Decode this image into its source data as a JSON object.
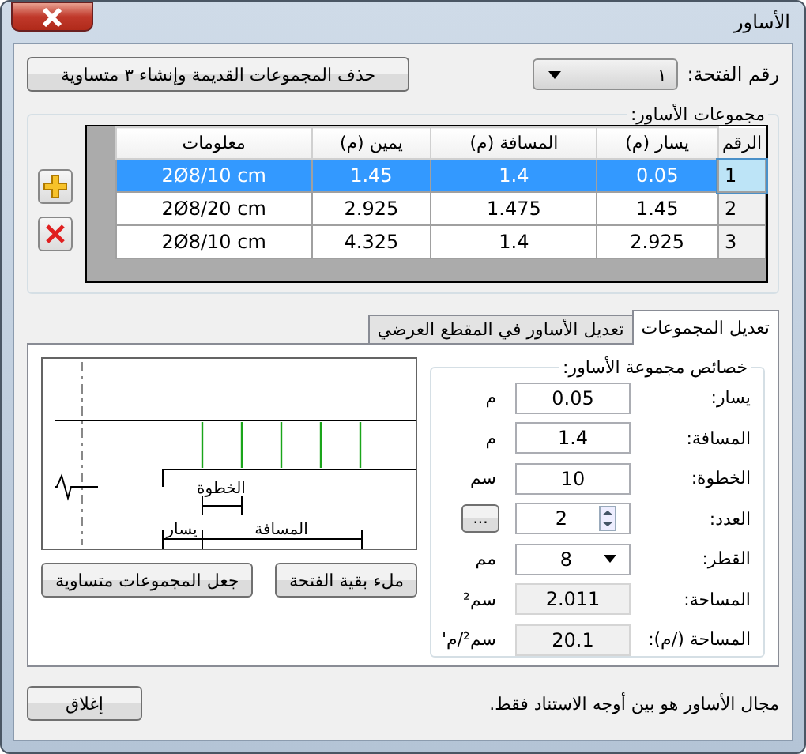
{
  "window": {
    "title": "الأساور"
  },
  "span": {
    "label": "رقم الفتحة:",
    "value": "١"
  },
  "recreate_button": "حذف المجموعات القديمة وإنشاء ٣ متساوية",
  "groups": {
    "title": "مجموعات الأساور:",
    "columns": [
      "الرقم",
      "يسار (م)",
      "المسافة (م)",
      "يمين (م)",
      "معلومات"
    ],
    "rows": [
      {
        "cells": [
          "1",
          "0.05",
          "1.4",
          "1.45",
          "2Ø8/10 cm"
        ],
        "selected": true
      },
      {
        "cells": [
          "2",
          "1.45",
          "1.475",
          "2.925",
          "2Ø8/20 cm"
        ],
        "selected": false
      },
      {
        "cells": [
          "3",
          "2.925",
          "1.4",
          "4.325",
          "2Ø8/10 cm"
        ],
        "selected": false
      }
    ]
  },
  "tabs": [
    {
      "label": "تعديل المجموعات",
      "selected": true
    },
    {
      "label": "تعديل الأساور في المقطع العرضي",
      "selected": false
    }
  ],
  "properties": {
    "title": "خصائص مجموعة الأساور:",
    "fields": [
      {
        "kind": "text",
        "label": "يسار:",
        "value": "0.05",
        "unit": "م"
      },
      {
        "kind": "text",
        "label": "المسافة:",
        "value": "1.4",
        "unit": "م"
      },
      {
        "kind": "text",
        "label": "الخطوة:",
        "value": "10",
        "unit": "سم"
      },
      {
        "kind": "spin",
        "label": "العدد:",
        "value": "2",
        "button": "..."
      },
      {
        "kind": "dropdown",
        "label": "القطر:",
        "value": "8",
        "unit": "مم"
      },
      {
        "kind": "readonly",
        "label": "المساحة:",
        "value": "2.011",
        "unit": "سم²"
      },
      {
        "kind": "readonly",
        "label": "المساحة (/م):",
        "value": "20.1",
        "unit": "سم²/م'"
      }
    ]
  },
  "diagram": {
    "step_label": "الخطوة",
    "left_label": "يسار",
    "distance_label": "المسافة"
  },
  "fill_button": "ملء بقية الفتحة",
  "equalize_button": "جعل المجموعات متساوية",
  "note": "مجال الأساور هو بين أوجه الاستناد فقط.",
  "close_button": "إغلاق"
}
